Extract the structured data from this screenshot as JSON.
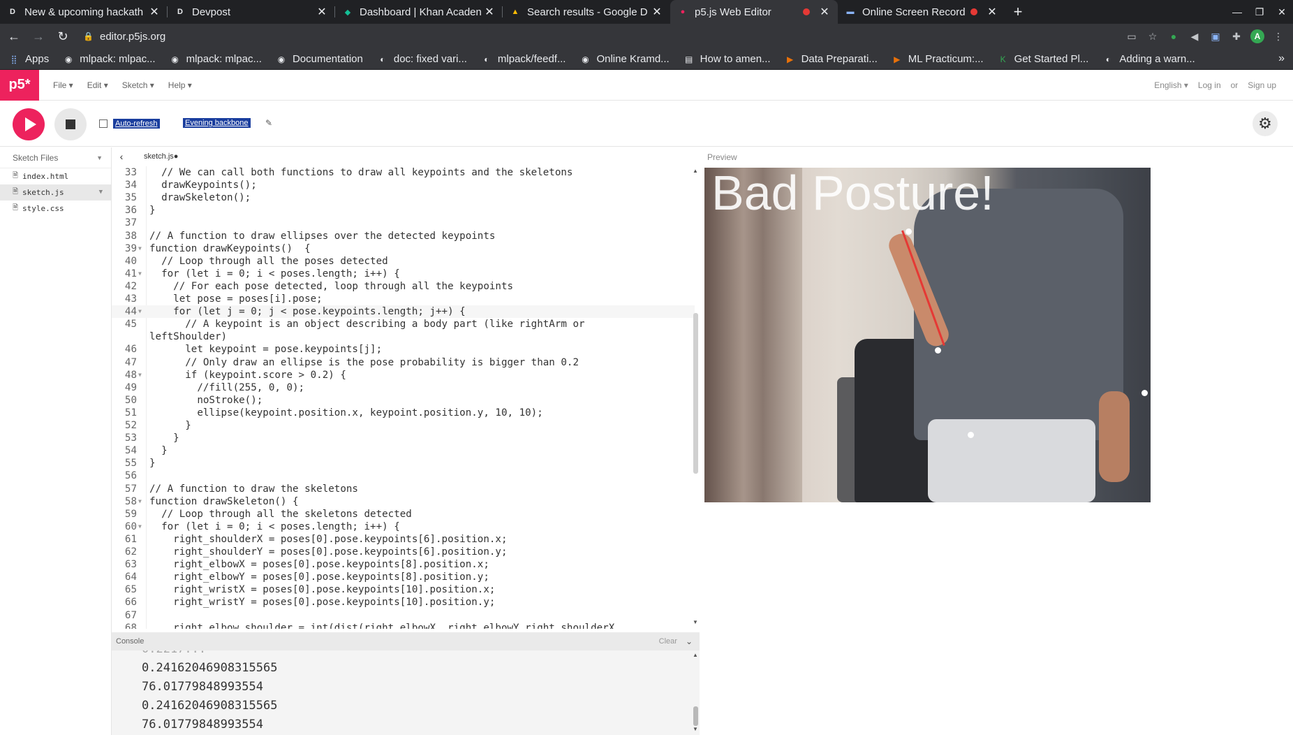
{
  "browser": {
    "tabs": [
      {
        "favicon": "D",
        "title": "New & upcoming hackath"
      },
      {
        "favicon": "D",
        "title": "Devpost"
      },
      {
        "favicon": "◆",
        "title": "Dashboard | Khan Acaden"
      },
      {
        "favicon": "▲",
        "title": "Search results - Google D"
      },
      {
        "favicon": "●",
        "title": "p5.js Web Editor"
      },
      {
        "favicon": "▬",
        "title": "Online Screen Record"
      }
    ],
    "url": "editor.p5js.org",
    "bookmarks": [
      "Apps",
      "mlpack: mlpac...",
      "mlpack: mlpac...",
      "Documentation",
      "doc: fixed vari...",
      "mlpack/feedf...",
      "Online Kramd...",
      "How to amen...",
      "Data Preparati...",
      "ML Practicum:...",
      "Get Started Pl...",
      "Adding a warn..."
    ],
    "avatar_initial": "A"
  },
  "p5": {
    "logo": "p5*",
    "menu": [
      "File ▾",
      "Edit ▾",
      "Sketch ▾",
      "Help ▾"
    ],
    "language": "English ▾",
    "login": "Log in",
    "or": "or",
    "signup": "Sign up",
    "auto_refresh": "Auto-refresh",
    "project_name": "Evening backbone",
    "sidebar_title": "Sketch Files",
    "files": [
      "index.html",
      "sketch.js",
      "style.css"
    ],
    "active_tab": "sketch.js●",
    "preview_label": "Preview",
    "console_label": "Console",
    "console_clear": "Clear",
    "preview_text": "Bad Posture!"
  },
  "code": [
    {
      "n": "33",
      "t": "  // We can call both functions to draw all keypoints and the skeletons"
    },
    {
      "n": "34",
      "t": "  drawKeypoints();"
    },
    {
      "n": "35",
      "t": "  drawSkeleton();"
    },
    {
      "n": "36",
      "t": "}"
    },
    {
      "n": "37",
      "t": ""
    },
    {
      "n": "38",
      "t": "// A function to draw ellipses over the detected keypoints"
    },
    {
      "n": "39",
      "t": "function drawKeypoints()  {",
      "fold": true
    },
    {
      "n": "40",
      "t": "  // Loop through all the poses detected"
    },
    {
      "n": "41",
      "t": "  for (let i = 0; i < poses.length; i++) {",
      "fold": true
    },
    {
      "n": "42",
      "t": "    // For each pose detected, loop through all the keypoints"
    },
    {
      "n": "43",
      "t": "    let pose = poses[i].pose;"
    },
    {
      "n": "44",
      "t": "    for (let j = 0; j < pose.keypoints.length; j++) {",
      "fold": true,
      "cur": true
    },
    {
      "n": "45",
      "t": "      // A keypoint is an object describing a body part (like rightArm or"
    },
    {
      "n": "",
      "t": "leftShoulder)"
    },
    {
      "n": "46",
      "t": "      let keypoint = pose.keypoints[j];"
    },
    {
      "n": "47",
      "t": "      // Only draw an ellipse is the pose probability is bigger than 0.2"
    },
    {
      "n": "48",
      "t": "      if (keypoint.score > 0.2) {",
      "fold": true
    },
    {
      "n": "49",
      "t": "        //fill(255, 0, 0);"
    },
    {
      "n": "50",
      "t": "        noStroke();"
    },
    {
      "n": "51",
      "t": "        ellipse(keypoint.position.x, keypoint.position.y, 10, 10);"
    },
    {
      "n": "52",
      "t": "      }"
    },
    {
      "n": "53",
      "t": "    }"
    },
    {
      "n": "54",
      "t": "  }"
    },
    {
      "n": "55",
      "t": "}"
    },
    {
      "n": "56",
      "t": ""
    },
    {
      "n": "57",
      "t": "// A function to draw the skeletons"
    },
    {
      "n": "58",
      "t": "function drawSkeleton() {",
      "fold": true
    },
    {
      "n": "59",
      "t": "  // Loop through all the skeletons detected"
    },
    {
      "n": "60",
      "t": "  for (let i = 0; i < poses.length; i++) {",
      "fold": true
    },
    {
      "n": "61",
      "t": "    right_shoulderX = poses[0].pose.keypoints[6].position.x;"
    },
    {
      "n": "62",
      "t": "    right_shoulderY = poses[0].pose.keypoints[6].position.y;"
    },
    {
      "n": "63",
      "t": "    right_elbowX = poses[0].pose.keypoints[8].position.x;"
    },
    {
      "n": "64",
      "t": "    right_elbowY = poses[0].pose.keypoints[8].position.y;"
    },
    {
      "n": "65",
      "t": "    right_wristX = poses[0].pose.keypoints[10].position.x;"
    },
    {
      "n": "66",
      "t": "    right_wristY = poses[0].pose.keypoints[10].position.y;"
    },
    {
      "n": "67",
      "t": ""
    },
    {
      "n": "68",
      "t": "    right_elbow_shoulder = int(dist(right_elbowX, right_elbowY,right_shoulderX,"
    }
  ],
  "console": [
    "0.24162046908315565",
    "76.01779848993554",
    "0.24162046908315565",
    "76.01779848993554"
  ]
}
